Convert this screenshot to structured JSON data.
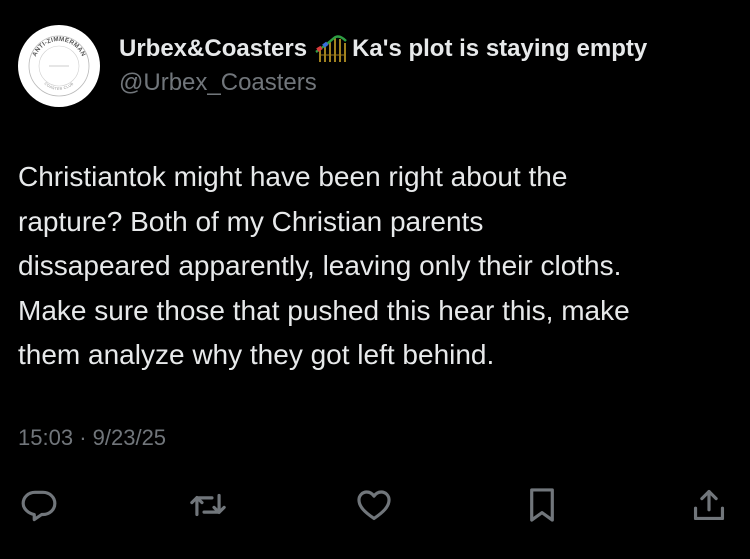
{
  "author": {
    "display_name": "Urbex&Coasters",
    "name_suffix": "Ka's plot is staying empty",
    "handle": "@Urbex_Coasters",
    "avatar_ring_text": "ANTI-ZIMMERMAN",
    "avatar_bottom_text": "COASTER CLUB",
    "emoji_icon": "roller-coaster-icon"
  },
  "tweet": {
    "text": "Christiantok might have been right about the\nrapture? Both of my Christian parents\ndissapeared apparently, leaving only their cloths.\nMake sure those that pushed this hear this, make\nthem analyze why they got left behind.",
    "time": "15:03",
    "separator": "·",
    "date": "9/23/25"
  },
  "actions": [
    {
      "name": "reply",
      "icon": "reply-icon"
    },
    {
      "name": "retweet",
      "icon": "retweet-icon"
    },
    {
      "name": "like",
      "icon": "heart-icon"
    },
    {
      "name": "bookmark",
      "icon": "bookmark-icon"
    },
    {
      "name": "share",
      "icon": "share-icon"
    }
  ],
  "colors": {
    "background": "#000000",
    "primary_text": "#e7e9ea",
    "secondary_text": "#71767b",
    "action_icon": "#71767b"
  }
}
